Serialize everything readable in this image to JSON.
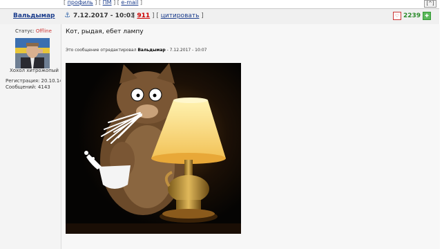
{
  "prev_post": {
    "links": [
      "профиль",
      "ПМ",
      "e-mail"
    ],
    "to_top": "[^]"
  },
  "post": {
    "author": "Вальдымар",
    "date": "7.12.2017 - 10:03",
    "number": "911",
    "quote_label": "цитировать",
    "reputation": "2239",
    "message": "Кот, рыдая, ебет лампу",
    "edited_prefix": "Это сообщение отредактировал",
    "edited_by": "Вальдымар",
    "edited_time": "- 7.12.2017 - 10:07"
  },
  "user": {
    "status_label": "Статус:",
    "status_value": "Offline",
    "title": "Хохол хитрожопый",
    "registration": "Регистрация: 20.10.14",
    "posts": "Сообщений: 4143"
  },
  "colors": {
    "link": "#1a3c8c",
    "post_number": "#cc0000",
    "reputation": "#2a8a2a",
    "offline": "#cc3333"
  },
  "icons": {
    "post_icon": "anchor-icon",
    "rep_down": "minus-shield-icon",
    "rep_up": "plus-icon"
  }
}
